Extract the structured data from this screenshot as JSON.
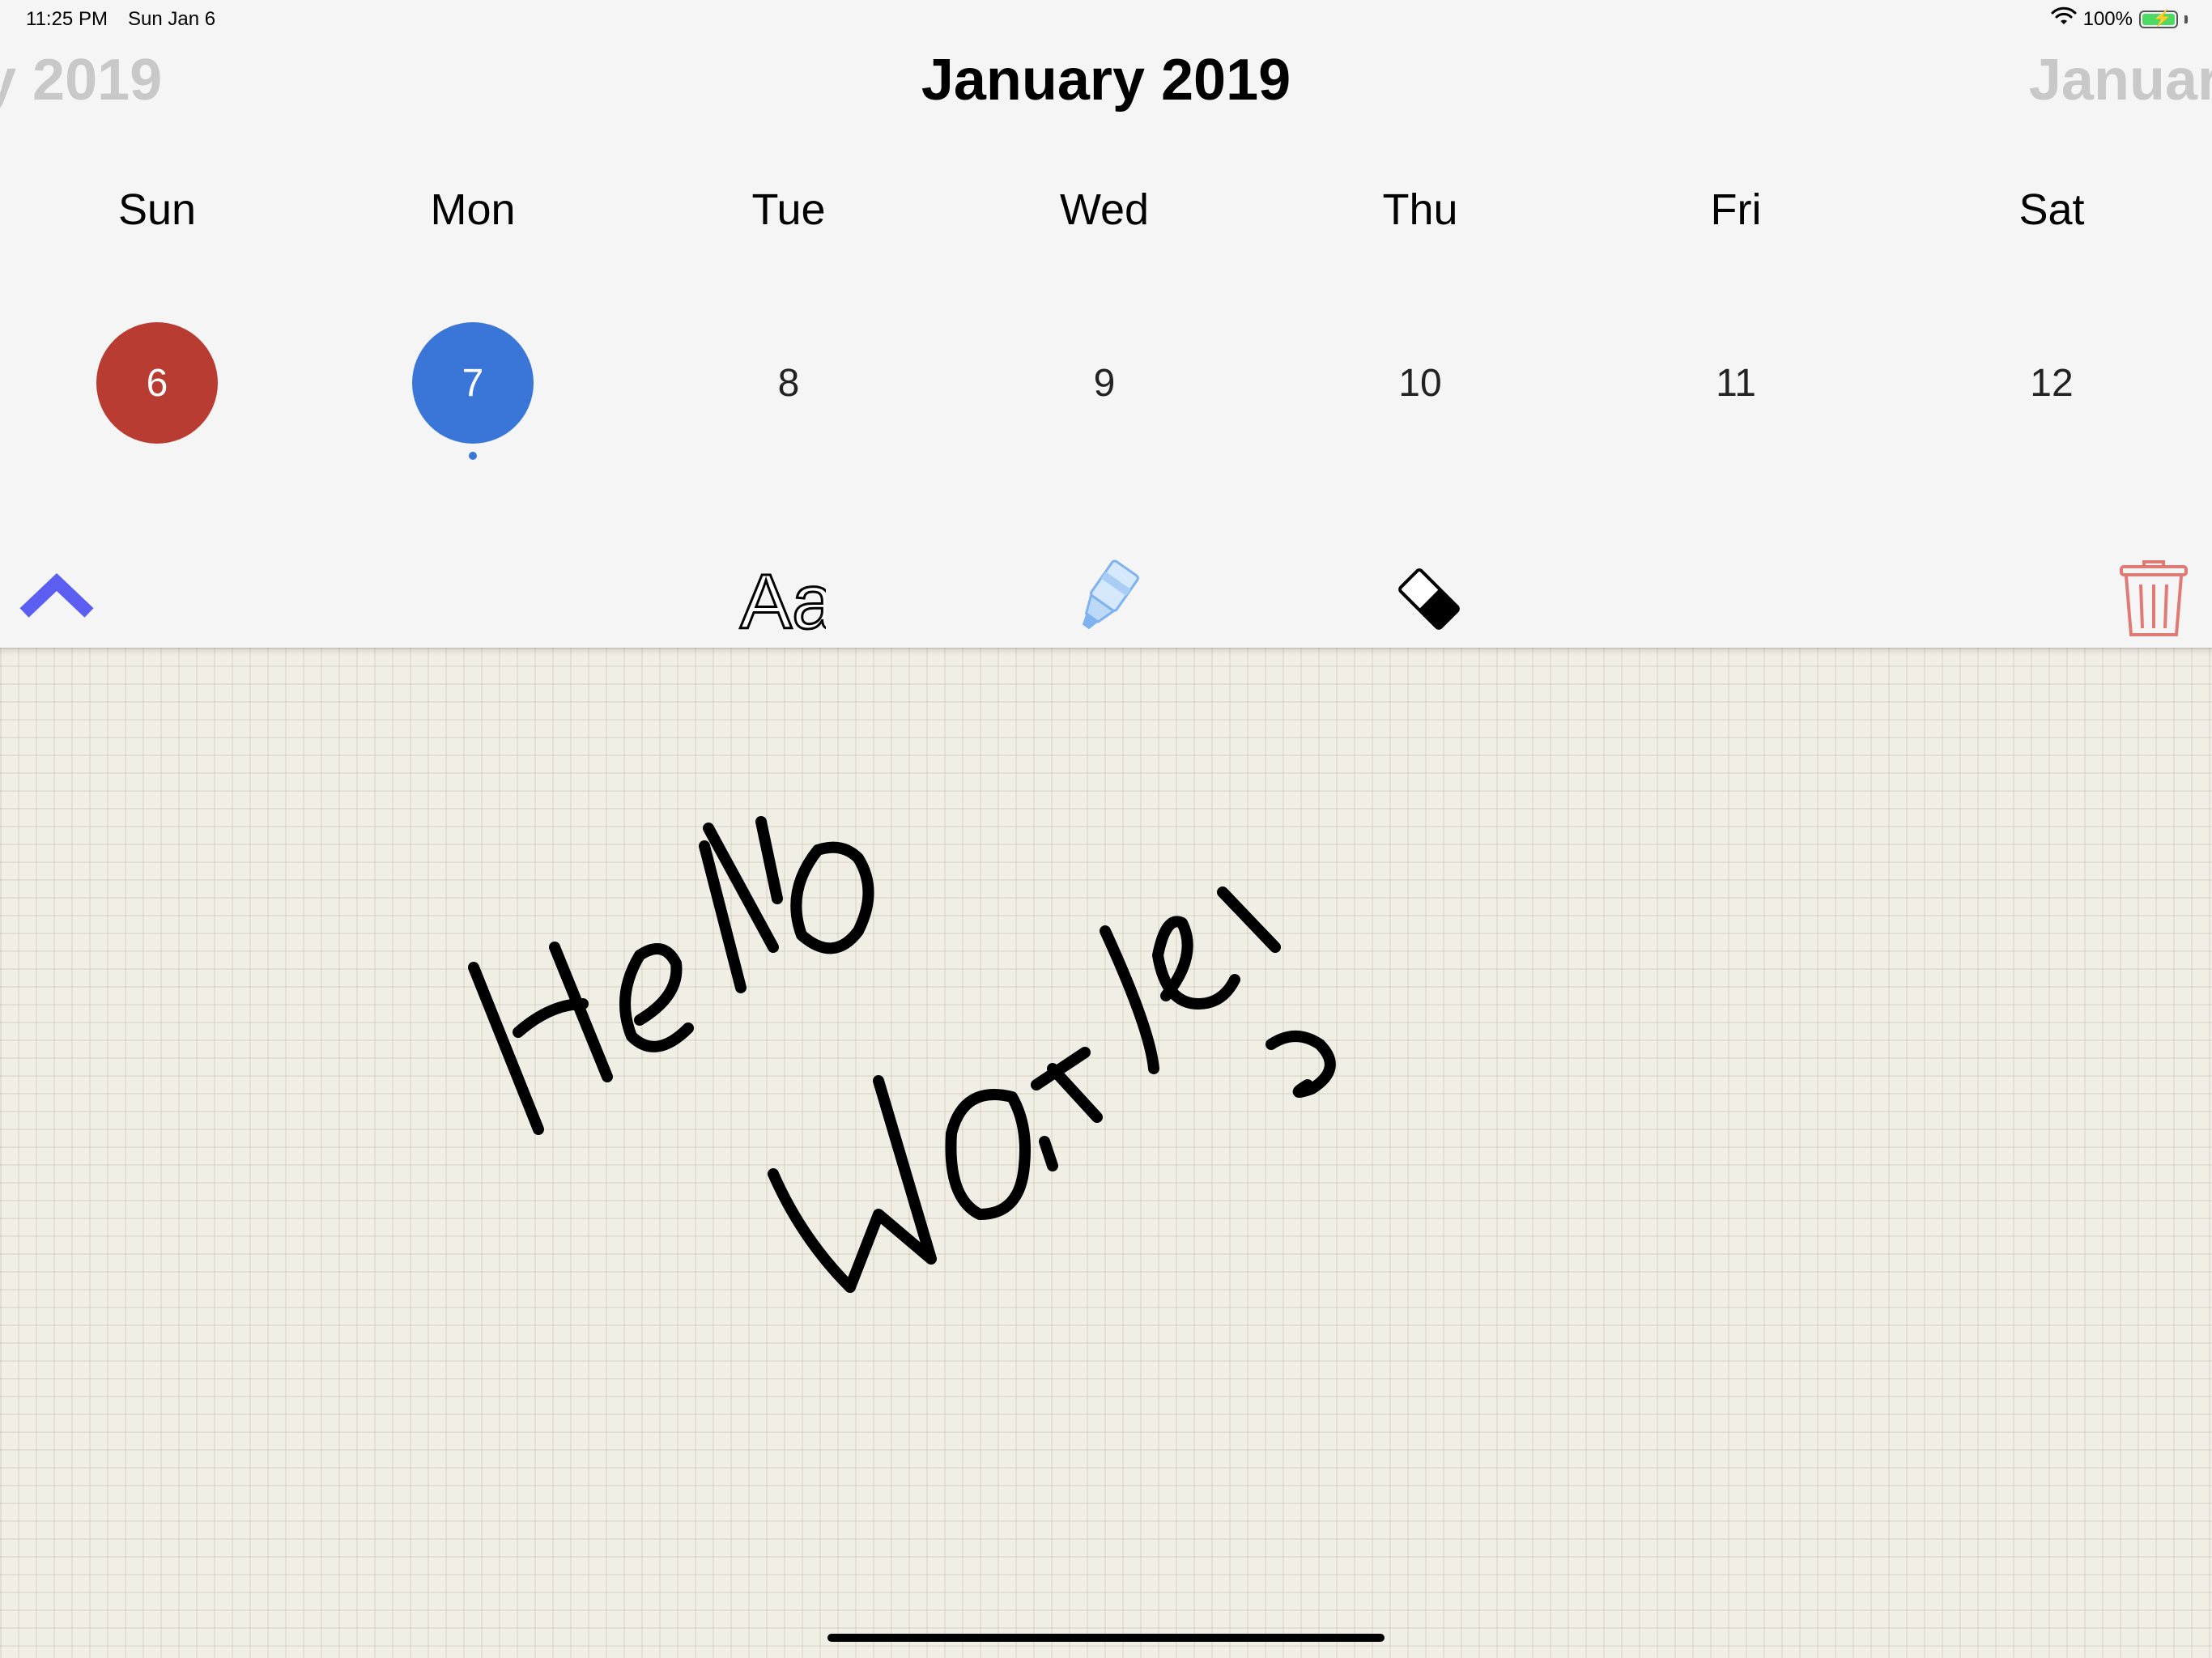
{
  "status_bar": {
    "time": "11:25 PM",
    "date": "Sun Jan 6",
    "battery_text": "100%",
    "battery_level": 1.0,
    "wifi_icon": "wifi-icon"
  },
  "calendar": {
    "title": "January 2019",
    "prev_month_partial": "y 2019",
    "next_month_partial": "Januar",
    "weekdays": [
      "Sun",
      "Mon",
      "Tue",
      "Wed",
      "Thu",
      "Fri",
      "Sat"
    ],
    "days": [
      "6",
      "7",
      "8",
      "9",
      "10",
      "11",
      "12"
    ],
    "today": "6",
    "selected": "7",
    "colors": {
      "today": "#b83c32",
      "selected": "#3a76d8"
    }
  },
  "toolbar": {
    "collapse_icon": "chevron-up-icon",
    "text_tool_label": "Aa",
    "highlighter_icon": "highlighter-icon",
    "eraser_icon": "eraser-icon",
    "trash_icon": "trash-icon",
    "colors": {
      "collapse": "#5b5ef0",
      "trash": "#e07a74"
    }
  },
  "canvas": {
    "background": "grid-paper",
    "handwriting": [
      "Hello",
      "World!"
    ]
  }
}
